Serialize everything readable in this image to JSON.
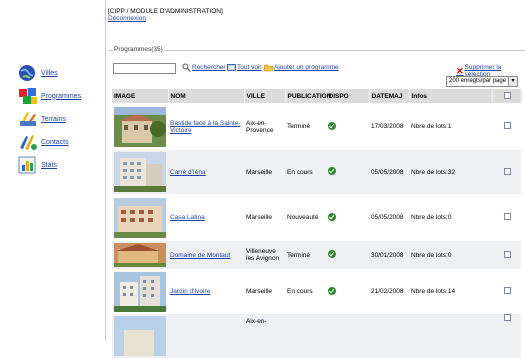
{
  "header": {
    "title": "[CIPP / MODULE D'ADMINISTRATION]",
    "logout": "Déconnexion"
  },
  "sidebar": {
    "items": [
      {
        "label": "Villes",
        "icon": "globe-icon"
      },
      {
        "label": "Programmes",
        "icon": "blocks-icon"
      },
      {
        "label": "Terrains",
        "icon": "tools-icon"
      },
      {
        "label": "Contacts",
        "icon": "contacts-icon"
      },
      {
        "label": "Stats",
        "icon": "stats-icon"
      }
    ]
  },
  "panel": {
    "legend": "Programmes(35)"
  },
  "toolbar": {
    "search_value": "",
    "search_label": "Rechercher",
    "view_all_label": "Tout voir",
    "add_label": "Ajouter un programme",
    "delete_selection_label": "Supprimer la sélection",
    "per_page_value": "200 enregts/par page"
  },
  "table": {
    "headers": [
      "IMAGE",
      "NOM",
      "VILLE",
      "PUBLICATION",
      "DISPO",
      "DATEMAJ",
      "Infos",
      ""
    ],
    "rows": [
      {
        "name": "Bastide face à la Sainte-Victoire",
        "city": "Aix-en-Provence",
        "publication": "Terminé",
        "date": "17/03/2008",
        "infos": "Nbre de lots:1"
      },
      {
        "name": "Carré d'Iéna",
        "city": "Marseille",
        "publication": "En cours",
        "date": "05/05/2008",
        "infos": "Nbre de lots:32"
      },
      {
        "name": "Casa Latina",
        "city": "Marseille",
        "publication": "Nouveauté",
        "date": "05/05/2008",
        "infos": "Nbre de lots:0"
      },
      {
        "name": "Domaine de Montaut",
        "city": "Villeneuve les Avignon",
        "publication": "Terminé",
        "date": "30/01/2008",
        "infos": "Nbre de lots:0"
      },
      {
        "name": "Jardin d'Ivoire",
        "city": "Marseille",
        "publication": "En cours",
        "date": "21/02/2008",
        "infos": "Nbre de lots:14"
      },
      {
        "name": "",
        "city": "Aix-en-",
        "publication": "",
        "date": "",
        "infos": ""
      }
    ]
  },
  "colors": {
    "accent_link": "#2244aa",
    "header_bg": "#dcdcdc",
    "alt_row_bg": "#eef0f3",
    "ok_green": "#2d8a2d"
  }
}
